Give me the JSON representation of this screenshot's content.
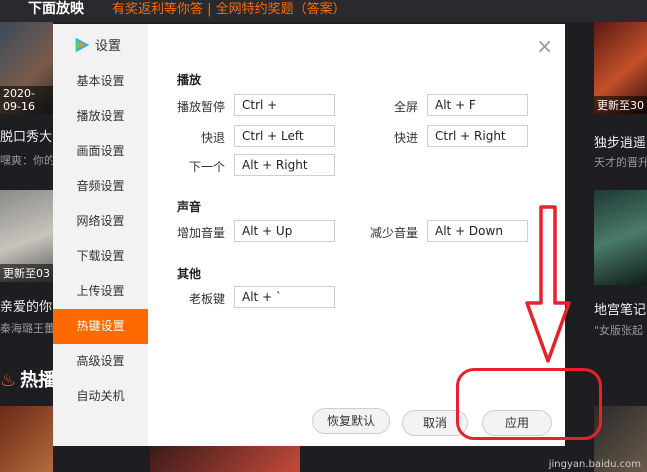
{
  "background": {
    "top_title": "下面放映",
    "top_tagline": "有奖返利等你答 | 全网特约奖题（答案）",
    "thumbs": [
      {
        "overlay": "2020-09-16"
      },
      {
        "overlay": "更新至30"
      },
      {
        "overlay": "更新至03"
      }
    ],
    "titles": [
      "脱口秀大会",
      "独步逍遥",
      "亲爱的你",
      "地宫笔记"
    ],
    "subs": [
      "嘿爽：你的",
      "天才的晋升",
      "秦海璐王蕾",
      "\"女版张起"
    ],
    "hot_label": "热播",
    "watermark": "jingyan.baidu.com"
  },
  "dialog": {
    "title": "设置",
    "close": "×",
    "nav": [
      {
        "label": "基本设置"
      },
      {
        "label": "播放设置"
      },
      {
        "label": "画面设置"
      },
      {
        "label": "音频设置"
      },
      {
        "label": "网络设置"
      },
      {
        "label": "下载设置"
      },
      {
        "label": "上传设置"
      },
      {
        "label": "热键设置"
      },
      {
        "label": "高级设置"
      },
      {
        "label": "自动关机"
      }
    ],
    "active_nav": "热键设置",
    "sections": {
      "play": "播放",
      "volume": "声音",
      "other": "其他"
    },
    "hotkeys": {
      "pause_label": "播放暂停",
      "pause_value": "Ctrl +",
      "fullscreen_label": "全屏",
      "fullscreen_value": "Alt + F",
      "rewind_label": "快退",
      "rewind_value": "Ctrl + Left",
      "forward_label": "快进",
      "forward_value": "Ctrl + Right",
      "next_label": "下一个",
      "next_value": "Alt + Right",
      "volup_label": "增加音量",
      "volup_value": "Alt + Up",
      "voldown_label": "减少音量",
      "voldown_value": "Alt + Down",
      "boss_label": "老板键",
      "boss_value": "Alt + `"
    },
    "buttons": {
      "restore": "恢复默认",
      "cancel": "取消",
      "apply": "应用"
    }
  },
  "colors": {
    "accent": "#ff6a00",
    "annotation": "#e8222a"
  }
}
